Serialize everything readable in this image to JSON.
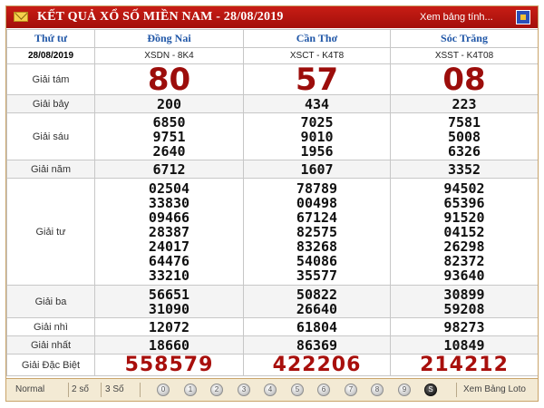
{
  "header": {
    "title": "KẾT QUẢ XỔ SỐ MIỀN NAM - 28/08/2019",
    "view_link": "Xem bảng tính..."
  },
  "table": {
    "columns": [
      "Thứ tư",
      "Đồng Nai",
      "Cần Thơ",
      "Sóc Trăng"
    ],
    "date": "28/08/2019",
    "codes": [
      "XSDN - 8K4",
      "XSCT - K4T8",
      "XSST - K4T08"
    ],
    "rows": [
      {
        "label": "Giải tám",
        "values": [
          [
            "80"
          ],
          [
            "57"
          ],
          [
            "08"
          ]
        ]
      },
      {
        "label": "Giải bảy",
        "values": [
          [
            "200"
          ],
          [
            "434"
          ],
          [
            "223"
          ]
        ]
      },
      {
        "label": "Giải sáu",
        "values": [
          [
            "6850",
            "9751",
            "2640"
          ],
          [
            "7025",
            "9010",
            "1956"
          ],
          [
            "7581",
            "5008",
            "6326"
          ]
        ]
      },
      {
        "label": "Giải năm",
        "values": [
          [
            "6712"
          ],
          [
            "1607"
          ],
          [
            "3352"
          ]
        ]
      },
      {
        "label": "Giải tư",
        "values": [
          [
            "02504",
            "33830",
            "09466",
            "28387",
            "24017",
            "64476",
            "33210"
          ],
          [
            "78789",
            "00498",
            "67124",
            "82575",
            "83268",
            "54086",
            "35577"
          ],
          [
            "94502",
            "65396",
            "91520",
            "04152",
            "26298",
            "82372",
            "93640"
          ]
        ]
      },
      {
        "label": "Giải ba",
        "values": [
          [
            "56651",
            "31090"
          ],
          [
            "50822",
            "26640"
          ],
          [
            "30899",
            "59208"
          ]
        ]
      },
      {
        "label": "Giải nhì",
        "values": [
          [
            "12072"
          ],
          [
            "61804"
          ],
          [
            "98273"
          ]
        ]
      },
      {
        "label": "Giải nhất",
        "values": [
          [
            "18660"
          ],
          [
            "86369"
          ],
          [
            "10849"
          ]
        ]
      },
      {
        "label": "Giải Đặc Biệt",
        "values": [
          [
            "558579"
          ],
          [
            "422206"
          ],
          [
            "214212"
          ]
        ]
      }
    ]
  },
  "footer": {
    "modes": [
      "Normal",
      "2 số",
      "3 Số"
    ],
    "digits": [
      "0",
      "1",
      "2",
      "3",
      "4",
      "5",
      "6",
      "7",
      "8",
      "9"
    ],
    "active_digit": "S",
    "view_loto": "Xem Bảng Loto"
  },
  "colors": {
    "header_bg": "#b8140f",
    "column_header": "#1f56a7",
    "highlight_number": "#9c0d0b",
    "footer_bg": "#f3ead4"
  }
}
